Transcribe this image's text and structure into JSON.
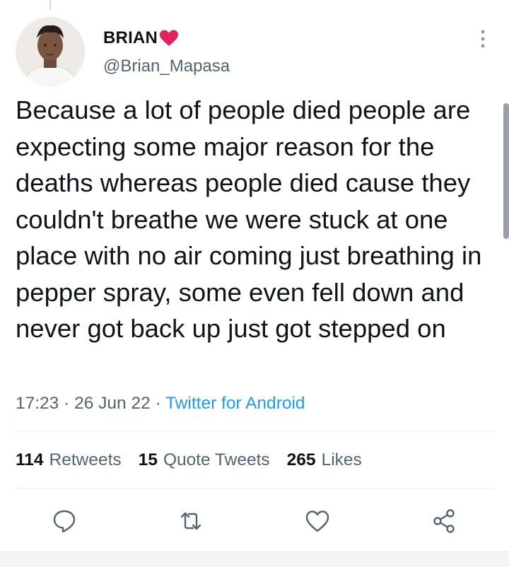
{
  "user": {
    "display_name": "BRIAN",
    "handle": "@Brian_Mapasa"
  },
  "tweet": {
    "text": "Because a lot of people died people are expecting some major reason for the deaths whereas people died cause they couldn't breathe we were stuck at one place with no air coming just breathing in pepper spray, some even fell down and never got back up just got stepped on",
    "time": "17:23",
    "separator": "·",
    "date": "26 Jun 22",
    "source": "Twitter for Android"
  },
  "stats": {
    "retweets_count": "114",
    "retweets_label": "Retweets",
    "quotes_count": "15",
    "quotes_label": "Quote Tweets",
    "likes_count": "265",
    "likes_label": "Likes"
  },
  "icons": {
    "name_emoji": "heart-icon",
    "more": "more-options-icon",
    "reply": "reply-icon",
    "retweet": "retweet-icon",
    "like": "like-icon",
    "share": "share-icon"
  },
  "colors": {
    "text": "#0f1419",
    "secondary": "#536471",
    "link": "#1d9bf0",
    "heart": "#e0245e"
  }
}
